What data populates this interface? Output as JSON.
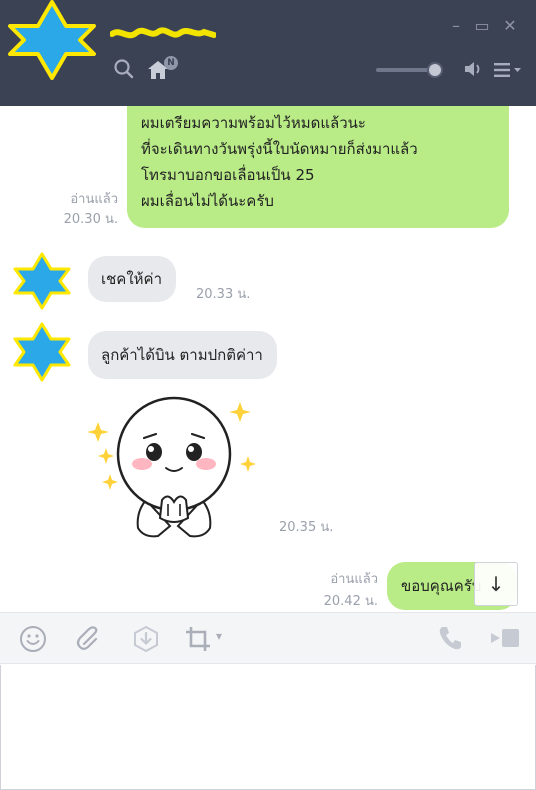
{
  "window": {
    "minimize_glyph": "–",
    "maximize_glyph": "▭",
    "close_glyph": "✕",
    "contact_name_scribbled": true,
    "icons": [
      "search-icon",
      "home-icon",
      "volume-icon",
      "menu-icon"
    ],
    "home_badge": "N",
    "volume_level": 0.9
  },
  "messages": {
    "m1": {
      "direction": "outgoing",
      "lines": [
        "ผมเตรียมความพร้อมไว้หมดแล้วนะ",
        "ที่จะเดินทางวันพรุ่งนี้ใบนัดหมายก็ส่งมาแล้ว",
        "โทรมาบอกขอเลื่อนเป็น 25",
        "ผมเลื่อนไม่ได้นะครับ"
      ],
      "read": "อ่านแล้ว",
      "time": "20.30 น."
    },
    "m2": {
      "direction": "incoming",
      "text": "เชคให้ค่า",
      "time": "20.33 น."
    },
    "m3": {
      "direction": "incoming",
      "text": "ลูกค้าได้บิน ตามปกติค่าา"
    },
    "m4": {
      "direction": "incoming",
      "sticker": "sticker-pleading-face",
      "time": "20.35 น."
    },
    "m5": {
      "direction": "outgoing",
      "text": "ขอบคุณครับ",
      "read": "อ่านแล้ว",
      "time": "20.42 น."
    }
  },
  "scroll_button_glyph": "↓",
  "toolbar": {
    "items": [
      "emoji-icon",
      "attach-icon",
      "download-icon",
      "crop-icon",
      "call-icon",
      "video-icon"
    ],
    "dropdown_glyph": "▾"
  },
  "colors": {
    "titlebar": "#3b4254",
    "outgoing_bubble": "#b9ec87",
    "incoming_bubble": "#e7e9ec",
    "avatar_star_fill": "#2ba8e8",
    "avatar_star_outline": "#ffe800"
  }
}
